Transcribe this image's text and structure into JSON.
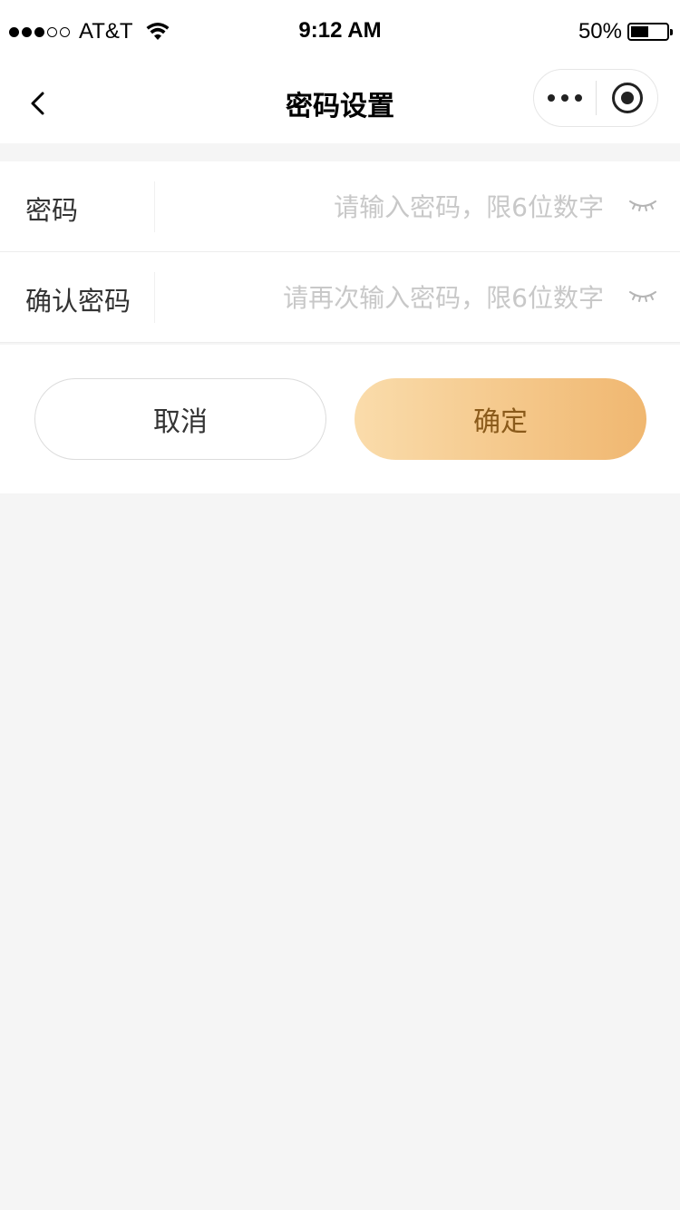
{
  "status_bar": {
    "carrier": "AT&T",
    "time": "9:12 AM",
    "battery": "50%",
    "battery_level": 0.5,
    "signal_bars_filled": 3,
    "signal_bars_total": 5
  },
  "nav": {
    "title": "密码设置",
    "back_icon": "chevron-left-icon",
    "more_icon": "more-dots-icon",
    "close_icon": "target-circle-icon"
  },
  "form": {
    "fields": [
      {
        "label": "密码",
        "value": "",
        "placeholder": "请输入密码，限6位数字",
        "icon": "eye-closed-icon"
      },
      {
        "label": "确认密码",
        "value": "",
        "placeholder": "请再次输入密码，限6位数字",
        "icon": "eye-closed-icon"
      }
    ]
  },
  "actions": {
    "cancel_label": "取消",
    "confirm_label": "确定"
  },
  "colors": {
    "accent_gradient_start": "#fadcab",
    "accent_gradient_end": "#f0b770",
    "confirm_text": "#8a5a1a",
    "page_background": "#f5f5f5",
    "placeholder": "#c8c8c8"
  }
}
